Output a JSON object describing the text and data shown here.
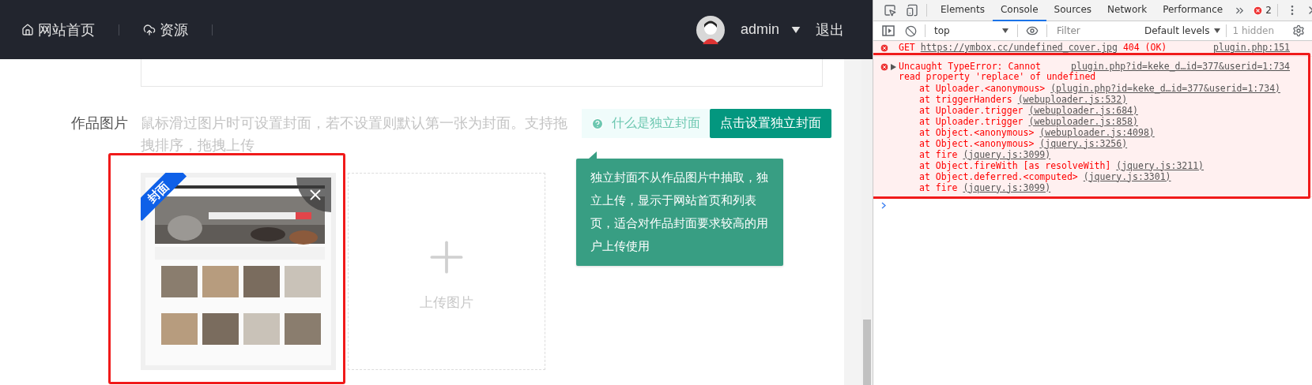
{
  "nav": {
    "items": [
      {
        "label": "网站首页"
      },
      {
        "label": "资源"
      }
    ],
    "user": {
      "name": "admin"
    },
    "logout": "退出"
  },
  "upload_section": {
    "label": "作品图片",
    "hint": "鼠标滑过图片时可设置封面，若不设置则默认第一张为封面。支持拖拽排序，拖拽上传",
    "help_link": "什么是独立封面",
    "set_cover_button": "点击设置独立封面",
    "tooltip": "独立封面不从作品图片中抽取，独立上传，显示于网站首页和列表页，适合对作品封面要求较高的用户上传使用",
    "images": [
      {
        "kind": "picture",
        "badge": "封面",
        "highlighted": true
      }
    ],
    "upload_tile": {
      "label": "上传图片"
    }
  },
  "devtools": {
    "tabs": [
      {
        "label": "Elements",
        "selected": false
      },
      {
        "label": "Console",
        "selected": true
      },
      {
        "label": "Sources",
        "selected": false
      },
      {
        "label": "Network",
        "selected": false
      },
      {
        "label": "Performance",
        "selected": false
      }
    ],
    "error_count": "2",
    "context": "top",
    "filter": {
      "placeholder": "Filter"
    },
    "levels": "Default levels",
    "hidden": "1 hidden",
    "messages": [
      {
        "kind": "request",
        "method": "GET",
        "url": "https://ymbox.cc/undefined_cover.jpg",
        "status": "404 (OK)",
        "source": "plugin.php:151",
        "highlighted": false
      },
      {
        "kind": "exception",
        "expanded": false,
        "message_lines": [
          "Uncaught TypeError: Cannot",
          "read property 'replace' of undefined"
        ],
        "source": "plugin.php?id=keke_d…id=377&userid=1:734",
        "highlighted": true,
        "stack": [
          {
            "call": "at Uploader.<anonymous>",
            "location": "(plugin.php?id=keke_d…id=377&userid=1:734)"
          },
          {
            "call": "at triggerHanders",
            "location": "(webuploader.js:532)"
          },
          {
            "call": "at Uploader.trigger",
            "location": "(webuploader.js:684)"
          },
          {
            "call": "at Uploader.trigger",
            "location": "(webuploader.js:858)"
          },
          {
            "call": "at Object.<anonymous>",
            "location": "(webuploader.js:4098)"
          },
          {
            "call": "at Object.<anonymous>",
            "location": "(jquery.js:3256)"
          },
          {
            "call": "at fire",
            "location": "(jquery.js:3099)"
          },
          {
            "call": "at Object.fireWith [as resolveWith]",
            "location": "(jquery.js:3211)"
          },
          {
            "call": "at Object.deferred.<computed>",
            "location": "(jquery.js:3301)"
          },
          {
            "call": "at fire",
            "location": "(jquery.js:3099)"
          }
        ]
      }
    ]
  }
}
